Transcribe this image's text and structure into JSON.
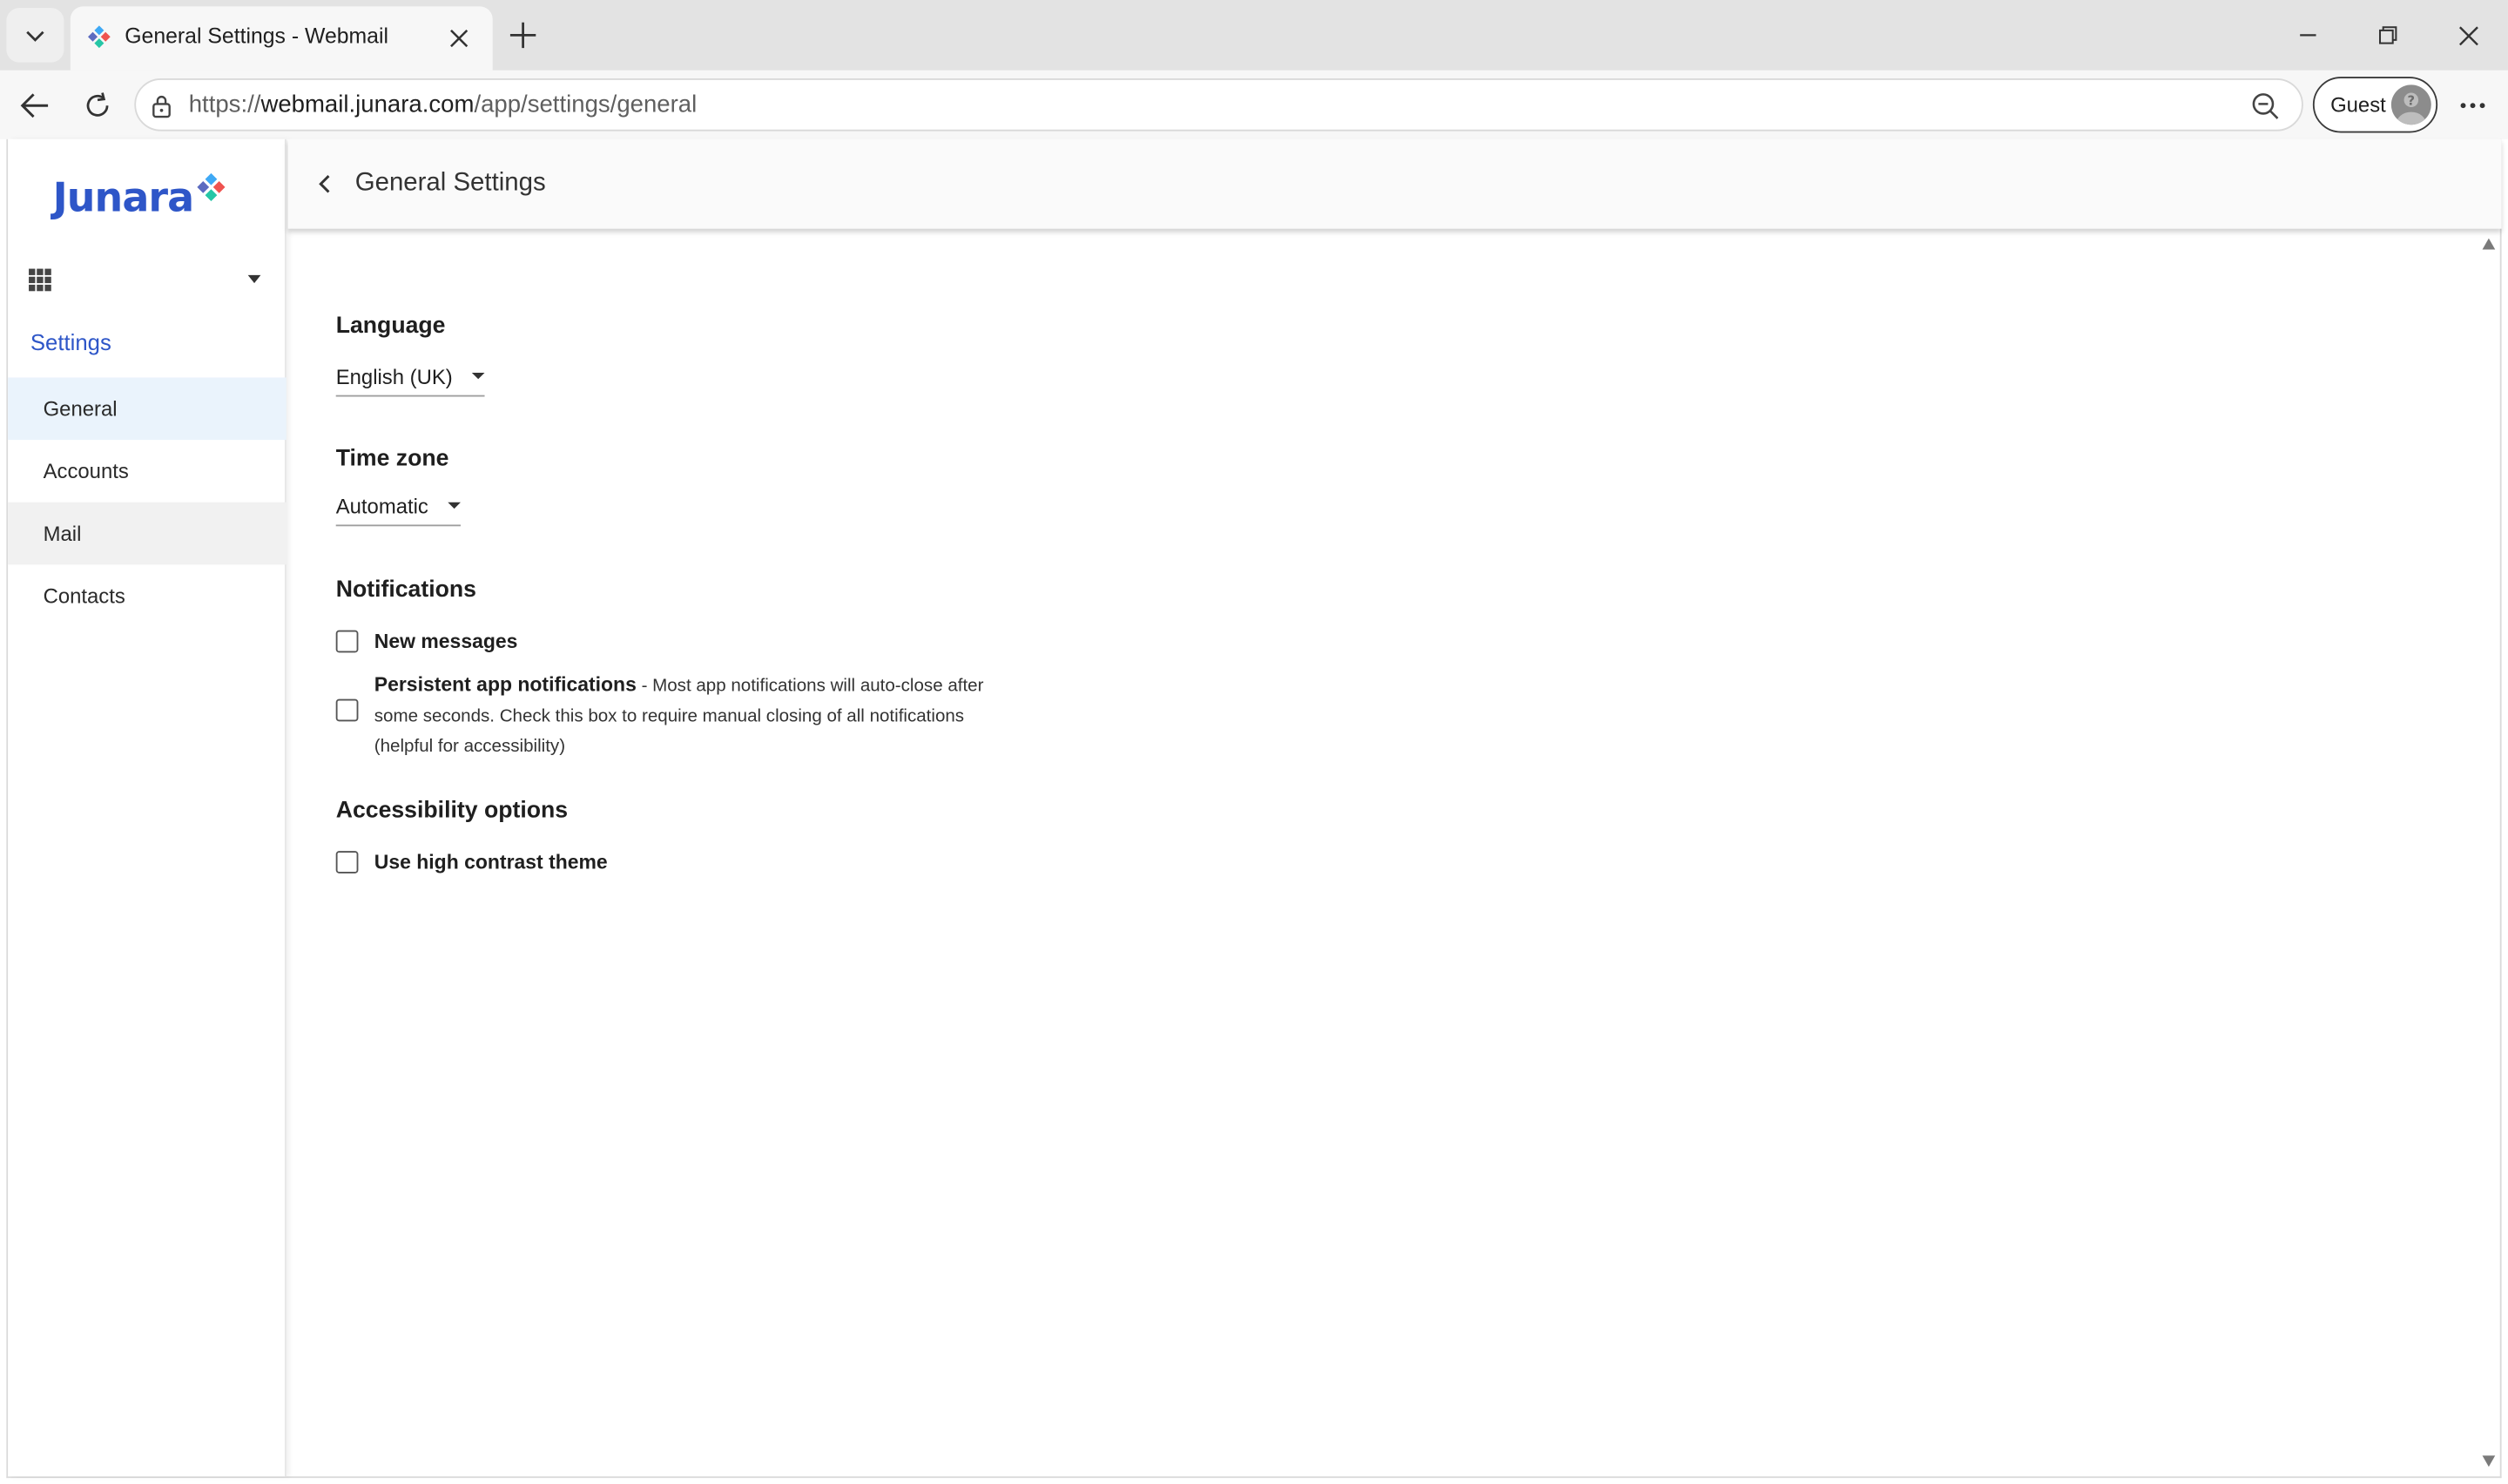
{
  "browser": {
    "tab_title": "General Settings - Webmail",
    "url_prefix": "https://",
    "url_host": "webmail.junara.com",
    "url_path": "/app/settings/general",
    "profile_label": "Guest"
  },
  "sidebar": {
    "logo_text": "Junara",
    "settings_heading": "Settings",
    "items": [
      {
        "label": "General"
      },
      {
        "label": "Accounts"
      },
      {
        "label": "Mail"
      },
      {
        "label": "Contacts"
      }
    ]
  },
  "header": {
    "title": "General Settings"
  },
  "language": {
    "title": "Language",
    "value": "English (UK)"
  },
  "timezone": {
    "title": "Time zone",
    "value": "Automatic"
  },
  "notifications": {
    "title": "Notifications",
    "new_messages": "New messages",
    "persistent_label": "Persistent app notifications",
    "persistent_desc": " - Most app notifications will auto-close after some seconds. Check this box to require manual closing of all notifications (helpful for accessibility)"
  },
  "accessibility": {
    "title": "Accessibility options",
    "high_contrast": "Use high contrast theme"
  },
  "colors": {
    "brand_blue": "#2e56c8",
    "active_nav_bg": "#eaf3fc"
  }
}
